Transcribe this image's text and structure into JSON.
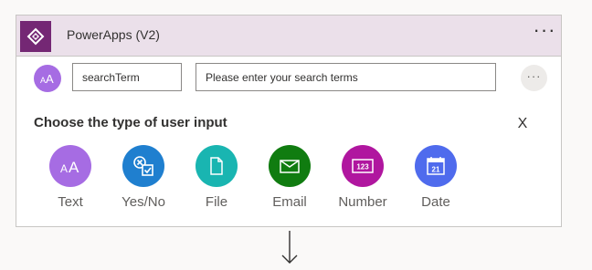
{
  "card": {
    "title": "PowerApps (V2)",
    "more_label": "···"
  },
  "parameter": {
    "name_value": "searchTerm",
    "description_value": "Please enter your search terms",
    "more_label": "···"
  },
  "input_panel": {
    "title": "Choose the type of user input",
    "close_label": "X",
    "types": [
      {
        "label": "Text",
        "icon": "text-icon",
        "color": "#a66ce3"
      },
      {
        "label": "Yes/No",
        "icon": "yes-no-icon",
        "color": "#1f7fcf"
      },
      {
        "label": "File",
        "icon": "file-icon",
        "color": "#19b5b1"
      },
      {
        "label": "Email",
        "icon": "email-icon",
        "color": "#107c10"
      },
      {
        "label": "Number",
        "icon": "number-icon",
        "color": "#b0169f"
      },
      {
        "label": "Date",
        "icon": "date-icon",
        "color": "#4f6bed"
      }
    ]
  },
  "colors": {
    "header_background": "#ebe0ea",
    "brand": "#742774"
  }
}
